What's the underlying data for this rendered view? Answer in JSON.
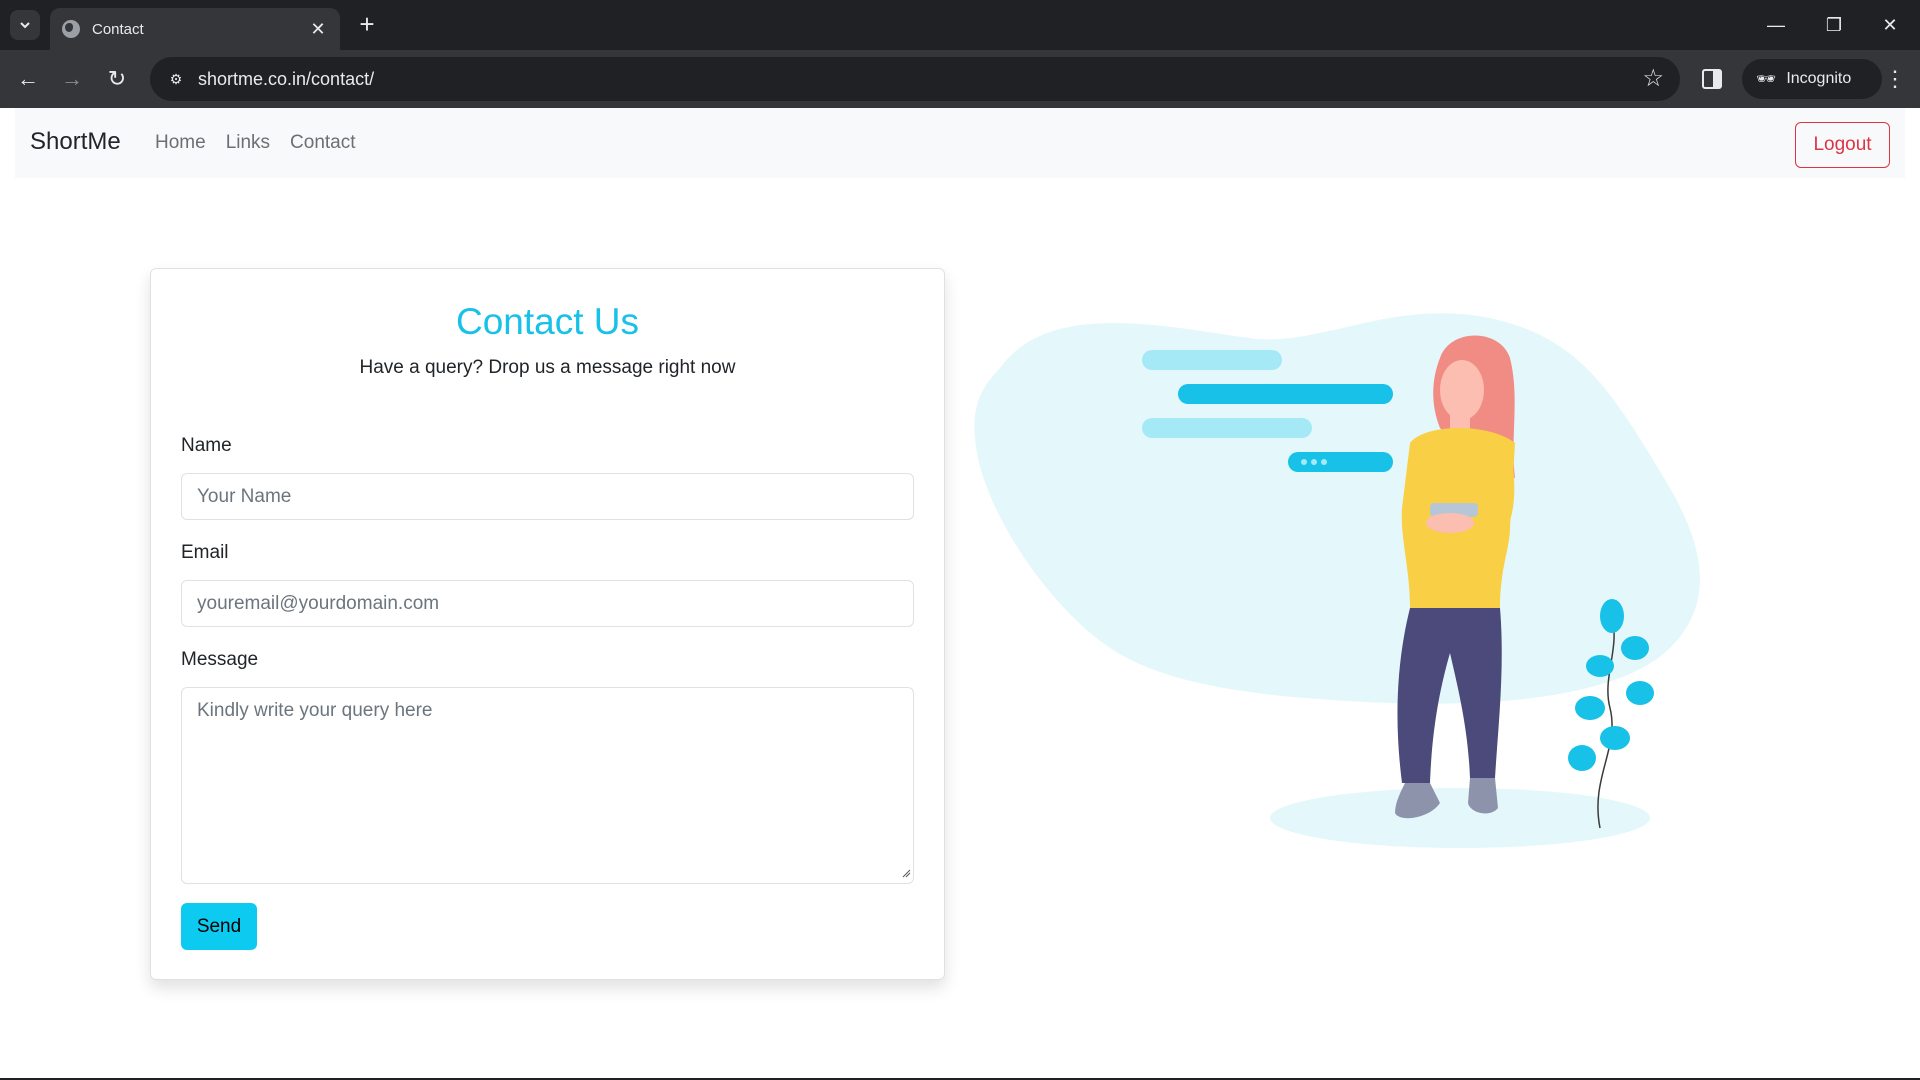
{
  "browser": {
    "tab_title": "Contact",
    "url": "shortme.co.in/contact/",
    "incognito_label": "Incognito",
    "icons": {
      "tab_search": "chevron-down-icon",
      "favicon": "globe-icon",
      "close": "close-icon",
      "new_tab": "plus-icon",
      "back": "arrow-left-icon",
      "forward": "arrow-right-icon",
      "reload": "reload-icon",
      "site_info": "tune-icon",
      "bookmark": "star-icon",
      "side_panel": "side-panel-icon",
      "incognito": "incognito-icon",
      "menu": "more-vert-icon",
      "minimize": "minimize-icon",
      "restore": "restore-icon",
      "window_close": "close-icon"
    }
  },
  "navbar": {
    "brand": "ShortMe",
    "links": [
      "Home",
      "Links",
      "Contact"
    ],
    "logout_label": "Logout"
  },
  "contact": {
    "title": "Contact Us",
    "subtitle": "Have a query? Drop us a message right now",
    "name_label": "Name",
    "name_placeholder": "Your Name",
    "name_value": "",
    "email_label": "Email",
    "email_placeholder": "youremail@yourdomain.com",
    "email_value": "",
    "message_label": "Message",
    "message_placeholder": "Kindly write your query here",
    "message_value": "",
    "send_label": "Send"
  },
  "colors": {
    "accent": "#17c1e8",
    "send_button": "#0dcaf0",
    "logout": "#dc3545",
    "navbar_bg": "#f8f9fa",
    "chrome_dark": "#202124",
    "chrome_mid": "#35363a"
  }
}
